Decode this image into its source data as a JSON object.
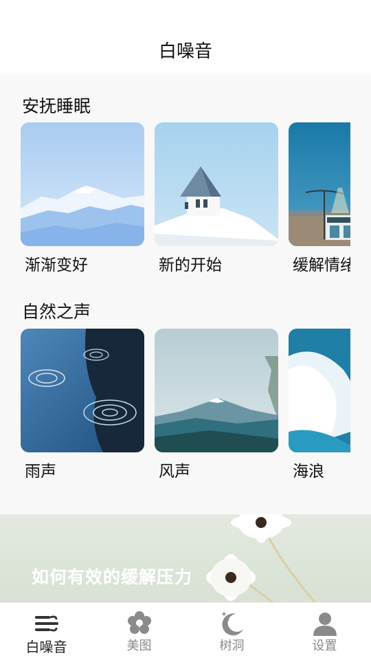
{
  "header": {
    "title": "白噪音"
  },
  "sections": [
    {
      "title": "安抚睡眠",
      "items": [
        {
          "label": "渐渐变好",
          "image": "snowy-mountains-photo"
        },
        {
          "label": "新的开始",
          "image": "snow-roof-house-photo"
        },
        {
          "label": "缓解情绪",
          "image": "street-lamp-shop-photo"
        }
      ]
    },
    {
      "title": "自然之声",
      "items": [
        {
          "label": "雨声",
          "image": "rain-ripples-photo"
        },
        {
          "label": "风声",
          "image": "mount-fuji-photo"
        },
        {
          "label": "海浪",
          "image": "ocean-waves-photo"
        }
      ]
    }
  ],
  "banner": {
    "title": "如何有效的缓解压力",
    "image": "white-daisy-flowers-photo"
  },
  "tabbar": {
    "active": "白噪音",
    "tabs": [
      {
        "label": "白噪音",
        "icon": "wind-icon"
      },
      {
        "label": "美图",
        "icon": "flower-icon"
      },
      {
        "label": "树洞",
        "icon": "moon-stars-icon"
      },
      {
        "label": "设置",
        "icon": "user-icon"
      }
    ]
  },
  "colors": {
    "background": "#f8f8f8",
    "tab_active": "#222222",
    "tab_inactive": "#8a8a8a"
  }
}
